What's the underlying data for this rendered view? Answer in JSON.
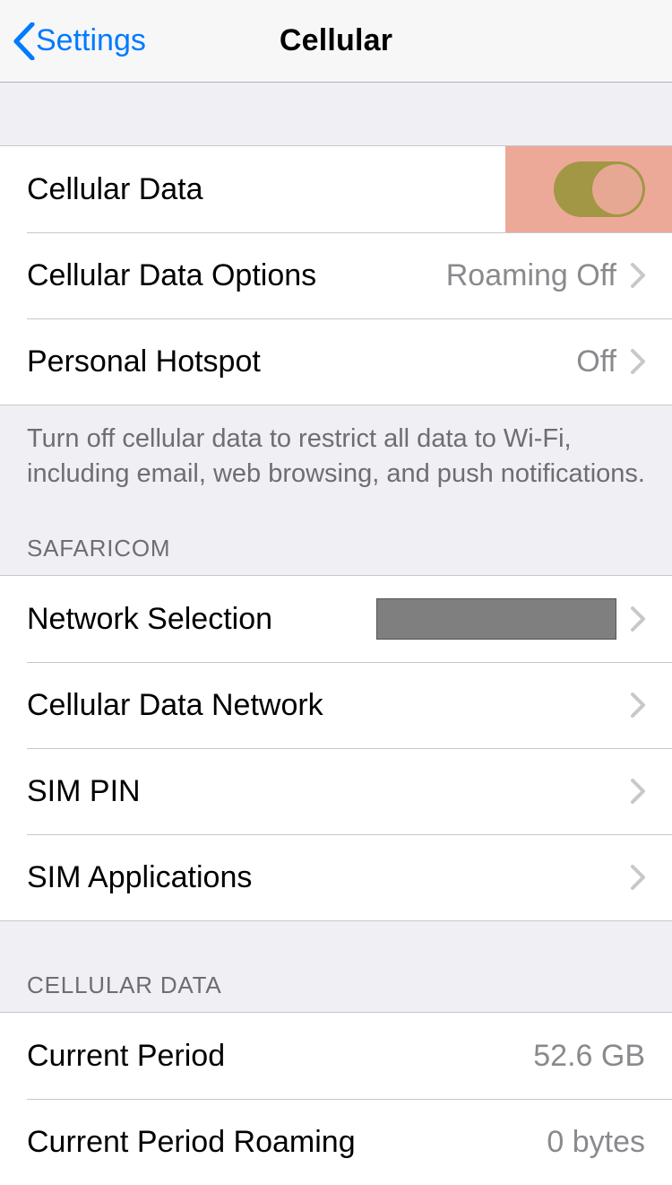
{
  "navbar": {
    "back_label": "Settings",
    "title": "Cellular"
  },
  "group1": {
    "cellular_data": {
      "label": "Cellular Data",
      "on": true
    },
    "cellular_data_options": {
      "label": "Cellular Data Options",
      "value": "Roaming Off"
    },
    "personal_hotspot": {
      "label": "Personal Hotspot",
      "value": "Off"
    },
    "footer": "Turn off cellular data to restrict all data to Wi-Fi, including email, web browsing, and push notifications."
  },
  "group2": {
    "header": "SAFARICOM",
    "network_selection": {
      "label": "Network Selection"
    },
    "cellular_data_network": {
      "label": "Cellular Data Network"
    },
    "sim_pin": {
      "label": "SIM PIN"
    },
    "sim_applications": {
      "label": "SIM Applications"
    }
  },
  "group3": {
    "header": "CELLULAR DATA",
    "current_period": {
      "label": "Current Period",
      "value": "52.6 GB"
    },
    "current_period_roaming": {
      "label": "Current Period Roaming",
      "value": "0 bytes"
    }
  }
}
